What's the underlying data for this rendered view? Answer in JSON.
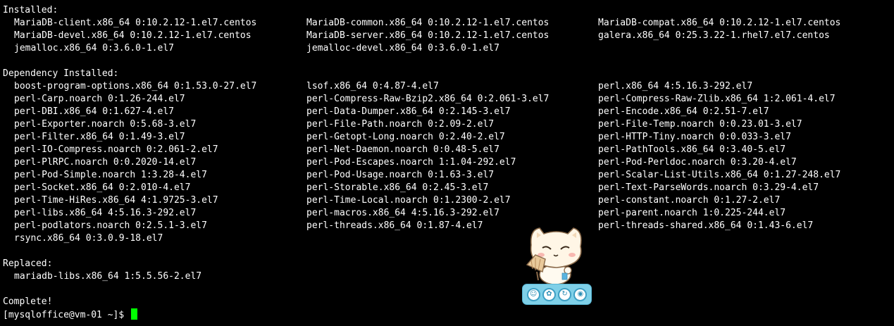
{
  "terminal": {
    "lines": [
      {
        "kind": "text",
        "text": "Installed:"
      },
      {
        "kind": "row",
        "cols": [
          "MariaDB-client.x86_64 0:10.2.12-1.el7.centos",
          "MariaDB-common.x86_64 0:10.2.12-1.el7.centos",
          "MariaDB-compat.x86_64 0:10.2.12-1.el7.centos"
        ]
      },
      {
        "kind": "row",
        "cols": [
          "MariaDB-devel.x86_64 0:10.2.12-1.el7.centos",
          "MariaDB-server.x86_64 0:10.2.12-1.el7.centos",
          "galera.x86_64 0:25.3.22-1.rhel7.el7.centos"
        ]
      },
      {
        "kind": "row",
        "cols": [
          "jemalloc.x86_64 0:3.6.0-1.el7",
          "jemalloc-devel.x86_64 0:3.6.0-1.el7",
          ""
        ]
      },
      {
        "kind": "text",
        "text": ""
      },
      {
        "kind": "text",
        "text": "Dependency Installed:"
      },
      {
        "kind": "row",
        "cols": [
          "boost-program-options.x86_64 0:1.53.0-27.el7",
          "lsof.x86_64 0:4.87-4.el7",
          "perl.x86_64 4:5.16.3-292.el7"
        ]
      },
      {
        "kind": "row",
        "cols": [
          "perl-Carp.noarch 0:1.26-244.el7",
          "perl-Compress-Raw-Bzip2.x86_64 0:2.061-3.el7",
          "perl-Compress-Raw-Zlib.x86_64 1:2.061-4.el7"
        ]
      },
      {
        "kind": "row",
        "cols": [
          "perl-DBI.x86_64 0:1.627-4.el7",
          "perl-Data-Dumper.x86_64 0:2.145-3.el7",
          "perl-Encode.x86_64 0:2.51-7.el7"
        ]
      },
      {
        "kind": "row",
        "cols": [
          "perl-Exporter.noarch 0:5.68-3.el7",
          "perl-File-Path.noarch 0:2.09-2.el7",
          "perl-File-Temp.noarch 0:0.23.01-3.el7"
        ]
      },
      {
        "kind": "row",
        "cols": [
          "perl-Filter.x86_64 0:1.49-3.el7",
          "perl-Getopt-Long.noarch 0:2.40-2.el7",
          "perl-HTTP-Tiny.noarch 0:0.033-3.el7"
        ]
      },
      {
        "kind": "row",
        "cols": [
          "perl-IO-Compress.noarch 0:2.061-2.el7",
          "perl-Net-Daemon.noarch 0:0.48-5.el7",
          "perl-PathTools.x86_64 0:3.40-5.el7"
        ]
      },
      {
        "kind": "row",
        "cols": [
          "perl-PlRPC.noarch 0:0.2020-14.el7",
          "perl-Pod-Escapes.noarch 1:1.04-292.el7",
          "perl-Pod-Perldoc.noarch 0:3.20-4.el7"
        ]
      },
      {
        "kind": "row",
        "cols": [
          "perl-Pod-Simple.noarch 1:3.28-4.el7",
          "perl-Pod-Usage.noarch 0:1.63-3.el7",
          "perl-Scalar-List-Utils.x86_64 0:1.27-248.el7"
        ]
      },
      {
        "kind": "row",
        "cols": [
          "perl-Socket.x86_64 0:2.010-4.el7",
          "perl-Storable.x86_64 0:2.45-3.el7",
          "perl-Text-ParseWords.noarch 0:3.29-4.el7"
        ]
      },
      {
        "kind": "row",
        "cols": [
          "perl-Time-HiRes.x86_64 4:1.9725-3.el7",
          "perl-Time-Local.noarch 0:1.2300-2.el7",
          "perl-constant.noarch 0:1.27-2.el7"
        ]
      },
      {
        "kind": "row",
        "cols": [
          "perl-libs.x86_64 4:5.16.3-292.el7",
          "perl-macros.x86_64 4:5.16.3-292.el7",
          "perl-parent.noarch 1:0.225-244.el7"
        ]
      },
      {
        "kind": "row",
        "cols": [
          "perl-podlators.noarch 0:2.5.1-3.el7",
          "perl-threads.x86_64 0:1.87-4.el7",
          "perl-threads-shared.x86_64 0:1.43-6.el7"
        ]
      },
      {
        "kind": "row",
        "cols": [
          "rsync.x86_64 0:3.0.9-18.el7",
          "",
          ""
        ]
      },
      {
        "kind": "text",
        "text": ""
      },
      {
        "kind": "text",
        "text": "Replaced:"
      },
      {
        "kind": "row",
        "cols": [
          "mariadb-libs.x86_64 1:5.5.56-2.el7",
          "",
          ""
        ]
      },
      {
        "kind": "text",
        "text": ""
      },
      {
        "kind": "text",
        "text": "Complete!"
      },
      {
        "kind": "prompt",
        "text": "[mysqloffice@vm-01 ~]$ "
      }
    ]
  },
  "colors": {
    "background": "#000000",
    "foreground": "#ffffff",
    "cursor": "#00ff00",
    "pet_toolbar": "#7fd0e8"
  },
  "pet_widget": {
    "character": "cat-with-fan-icon",
    "buttons": [
      {
        "name": "pet-menu-button",
        "glyph": "☺"
      },
      {
        "name": "pet-chat-button",
        "glyph": "✿"
      },
      {
        "name": "pet-refresh-button",
        "glyph": "↻"
      },
      {
        "name": "pet-settings-button",
        "glyph": "◉"
      }
    ]
  }
}
